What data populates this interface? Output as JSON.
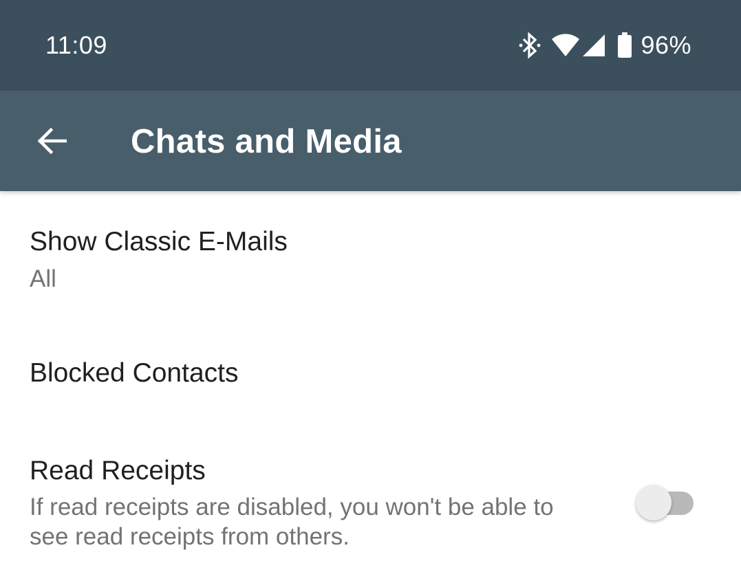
{
  "status_bar": {
    "time": "11:09",
    "battery_percent": "96%",
    "icons": [
      "bluetooth-icon",
      "wifi-icon",
      "cell-signal-icon",
      "battery-icon"
    ]
  },
  "app_bar": {
    "back_icon": "arrow-left-icon",
    "title": "Chats and Media"
  },
  "settings": [
    {
      "title": "Show Classic E-Mails",
      "summary": "All"
    },
    {
      "title": "Blocked Contacts"
    },
    {
      "title": "Read Receipts",
      "summary": "If read receipts are disabled, you won't be able to see read receipts from others.",
      "toggle_on": false
    }
  ],
  "colors": {
    "status_bar": "#3c4f5c",
    "app_bar": "#485e6b",
    "title_text": "#202020",
    "summary_text": "#737373"
  }
}
